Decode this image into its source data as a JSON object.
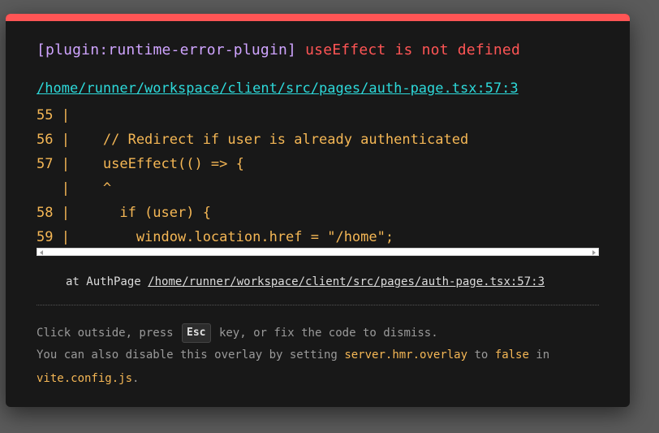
{
  "error": {
    "plugin": "[plugin:runtime-error-plugin]",
    "message": "useEffect is not defined",
    "file": "/home/runner/workspace/client/src/pages/auth-page.tsx:57:3"
  },
  "code_frame": [
    "55 |",
    "56 |    // Redirect if user is already authenticated",
    "57 |    useEffect(() => {",
    "   |    ^",
    "58 |      if (user) {",
    "59 |        window.location.href = \"/home\";"
  ],
  "stack": {
    "prefix": "at AuthPage",
    "location": "/home/runner/workspace/client/src/pages/auth-page.tsx:57:3"
  },
  "tips": {
    "line1_before": "Click outside, press",
    "esc_key": "Esc",
    "line1_after": "key, or fix the code to dismiss.",
    "line2_before": "You can also disable this overlay by setting",
    "setting": "server.hmr.overlay",
    "line2_to": "to",
    "value": "false",
    "line2_in": "in",
    "config_file": "vite.config.js",
    "period": "."
  },
  "colors": {
    "accent_bar": "#ff5555",
    "plugin_text": "#cfa4ff",
    "message_text": "#ff5555",
    "link": "#2dd9da",
    "code": "#f5b755",
    "background": "#181818"
  }
}
